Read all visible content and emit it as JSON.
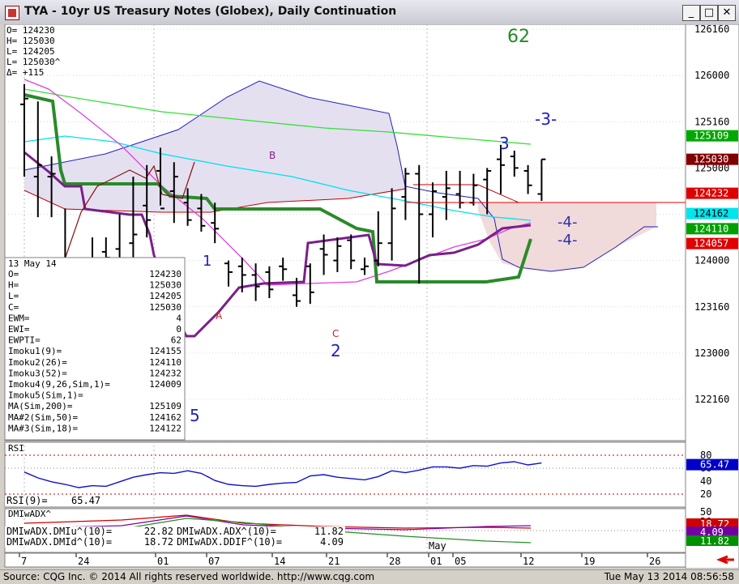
{
  "window": {
    "title": "TYA - 10yr US Treasury Notes (Globex), Daily Continuation",
    "buttons": {
      "minimize": "_",
      "maximize": "□",
      "close": "✕"
    }
  },
  "quote_box": [
    "O=  124230",
    "H=  125030",
    "L=  124205",
    "L=  125030^",
    "Δ=     +115"
  ],
  "info_panel": {
    "date": "13 May 14",
    "rows": [
      [
        "O=",
        "124230"
      ],
      [
        "H=",
        "125030"
      ],
      [
        "L=",
        "124205"
      ],
      [
        "C=",
        "125030"
      ],
      [
        "EWM=",
        "4"
      ],
      [
        "EWI=",
        "0"
      ],
      [
        "EWPTI=",
        "62"
      ],
      [
        "Imoku1(9)=",
        "124155"
      ],
      [
        "Imoku2(26)=",
        "124110"
      ],
      [
        "Imoku3(52)=",
        "124232"
      ],
      [
        "Imoku4(9,26,Sim,1)=",
        "124009"
      ],
      [
        "Imoku5(Sim,1)=",
        ""
      ],
      [
        "MA(Sim,200)=",
        "125109"
      ],
      [
        "MA#2(Sim,50)=",
        "124162"
      ],
      [
        "MA#3(Sim,18)=",
        "124122"
      ]
    ]
  },
  "price_axis": {
    "ticks": [
      "126160",
      "126000",
      "125160",
      "125000",
      "124160",
      "124000",
      "123160",
      "123000",
      "122160"
    ],
    "tags": [
      {
        "text": "125109",
        "bg": "#00a800",
        "fg": "#ffffff"
      },
      {
        "text": "125030",
        "bg": "#800000",
        "fg": "#ffffff"
      },
      {
        "text": "124232",
        "bg": "#e00000",
        "fg": "#ffffff"
      },
      {
        "text": "124162",
        "bg": "#00e5ee",
        "fg": "#000000"
      },
      {
        "text": "124110",
        "bg": "#00a000",
        "fg": "#ffffff"
      },
      {
        "text": "124057",
        "bg": "#e00000",
        "fg": "#ffffff"
      }
    ]
  },
  "wave_labels": [
    "62",
    "-3-",
    "3",
    "1",
    "A",
    "B",
    "C",
    "2",
    "5",
    "-4-",
    "-4-"
  ],
  "rsi": {
    "title": "RSI",
    "readout_label": "RSI(9)=",
    "readout_value": "65.47",
    "ticks": [
      "80",
      "60",
      "40",
      "20"
    ],
    "tag": {
      "text": "65.47",
      "bg": "#0000c8",
      "fg": "#ffffff"
    }
  },
  "dmi": {
    "title": "DMIwADX^",
    "readouts": [
      [
        "DMIwADX.DMIu^(10)=",
        "22.82"
      ],
      [
        "DMIwADX.ADX^(10)=",
        "11.82"
      ],
      [
        "DMIwADX.DMId^(10)=",
        "18.72"
      ],
      [
        "DMIwADX.DDIF^(10)=",
        "4.09"
      ]
    ],
    "ticks": [
      "50",
      "30"
    ],
    "tags": [
      {
        "text": "18.72",
        "bg": "#d00000",
        "fg": "#ffffff"
      },
      {
        "text": "4.09",
        "bg": "#7000a0",
        "fg": "#ffffff"
      },
      {
        "text": "11.82",
        "bg": "#009000",
        "fg": "#ffffff"
      }
    ]
  },
  "date_axis": {
    "labels": [
      "7",
      "24",
      "01",
      "07",
      "14",
      "21",
      "28",
      "01",
      "05",
      "12",
      "19",
      "26"
    ],
    "month": "May"
  },
  "footer": {
    "copyright": "Source: CQG Inc. © 2014 All rights reserved worldwide. http://www.cqg.com",
    "timestamp": "Tue May 13 2014 08:56:58"
  },
  "chart_data": {
    "type": "bar",
    "title": "TYA - 10yr US Treasury Notes (Globex), Daily Continuation",
    "ohlc": [
      {
        "o": 125220,
        "h": 125290,
        "l": 124290,
        "c": 125240
      },
      {
        "o": 124290,
        "h": 125230,
        "l": 124150,
        "c": 125010
      },
      {
        "o": 124290,
        "h": 125040,
        "l": 124150,
        "c": 124300
      },
      {
        "o": 123300,
        "h": 124180,
        "l": 122310,
        "c": 123030
      },
      {
        "o": 123250,
        "h": 124000,
        "l": 123220,
        "c": 123270
      },
      {
        "o": 123280,
        "h": 124080,
        "l": 123200,
        "c": 123320
      },
      {
        "o": 124030,
        "h": 124080,
        "l": 123280,
        "c": 124010
      },
      {
        "o": 124040,
        "h": 124160,
        "l": 123280,
        "c": 123300
      },
      {
        "o": 124060,
        "h": 124290,
        "l": 124010,
        "c": 124090
      },
      {
        "o": 124190,
        "h": 125010,
        "l": 124080,
        "c": 124140
      },
      {
        "o": 124310,
        "h": 125070,
        "l": 124190,
        "c": 124180
      },
      {
        "o": 124240,
        "h": 125020,
        "l": 124130,
        "c": 124290
      },
      {
        "o": 124200,
        "h": 124250,
        "l": 124120,
        "c": 124140
      },
      {
        "o": 124180,
        "h": 124230,
        "l": 124100,
        "c": 124120
      },
      {
        "o": 124130,
        "h": 124200,
        "l": 124060,
        "c": 124110
      },
      {
        "o": 123310,
        "h": 124000,
        "l": 123230,
        "c": 123280
      },
      {
        "o": 123300,
        "h": 124010,
        "l": 123210,
        "c": 123270
      },
      {
        "o": 123270,
        "h": 123310,
        "l": 123180,
        "c": 123230
      },
      {
        "o": 123280,
        "h": 123300,
        "l": 123190,
        "c": 123220
      },
      {
        "o": 123300,
        "h": 124010,
        "l": 123250,
        "c": 123290
      },
      {
        "o": 123200,
        "h": 123260,
        "l": 123160,
        "c": 123180
      },
      {
        "o": 123300,
        "h": 123310,
        "l": 123170,
        "c": 123210
      },
      {
        "o": 124040,
        "h": 124090,
        "l": 123270,
        "c": 124020
      },
      {
        "o": 124000,
        "h": 124080,
        "l": 123280,
        "c": 124050
      },
      {
        "o": 124070,
        "h": 124090,
        "l": 123290,
        "c": 124000
      },
      {
        "o": 123290,
        "h": 124010,
        "l": 123270,
        "c": 123300
      },
      {
        "o": 124000,
        "h": 124170,
        "l": 123300,
        "c": 124060
      },
      {
        "o": 124060,
        "h": 124250,
        "l": 124000,
        "c": 124180
      },
      {
        "o": 124220,
        "h": 125000,
        "l": 124140,
        "c": 124300
      },
      {
        "o": 124300,
        "h": 125010,
        "l": 123240,
        "c": 124160
      },
      {
        "o": 124160,
        "h": 124270,
        "l": 124080,
        "c": 124240
      },
      {
        "o": 124220,
        "h": 124310,
        "l": 124140,
        "c": 124250
      },
      {
        "o": 124230,
        "h": 124310,
        "l": 124180,
        "c": 124200
      },
      {
        "o": 124200,
        "h": 124300,
        "l": 124190,
        "c": 124260
      },
      {
        "o": 124280,
        "h": 125000,
        "l": 124160,
        "c": 124310
      },
      {
        "o": 125030,
        "h": 125080,
        "l": 124230,
        "c": 125010
      },
      {
        "o": 125040,
        "h": 125060,
        "l": 124290,
        "c": 125000
      },
      {
        "o": 124310,
        "h": 125010,
        "l": 124230,
        "c": 124260
      },
      {
        "o": 124230,
        "h": 125030,
        "l": 124205,
        "c": 125030
      }
    ],
    "ylim": [
      122160,
      126160
    ],
    "tick_labels": [
      "126160",
      "126000",
      "125160",
      "125000",
      "124160",
      "124000",
      "123160",
      "123000",
      "122160"
    ],
    "x_labels": [
      "7",
      "24",
      "01",
      "07",
      "14",
      "21",
      "28",
      "01",
      "05",
      "12",
      "19",
      "26"
    ],
    "annotations": [
      "62",
      "-3-",
      "3",
      "1",
      "A",
      "B",
      "C",
      "2",
      "5",
      "-4-",
      "-4-"
    ],
    "colors": {
      "ma200": "#33e033",
      "ma50": "#00e0f0",
      "ma18": "#e040e0",
      "kijun": "#2a8a2a",
      "tenkan": "#7a1f8a",
      "cloud_edge_a": "#2020c0",
      "cloud_edge_b": "#c00000",
      "bars": "#000000"
    },
    "rsi_values": [
      54,
      45,
      39,
      35,
      30,
      33,
      32,
      39,
      46,
      50,
      53,
      52,
      56,
      52,
      41,
      35,
      33,
      32,
      35,
      37,
      38,
      48,
      50,
      46,
      44,
      42,
      47,
      56,
      53,
      57,
      62,
      62,
      60,
      64,
      63,
      68,
      70,
      65,
      68
    ],
    "rsi_ylim": [
      0,
      100
    ]
  }
}
